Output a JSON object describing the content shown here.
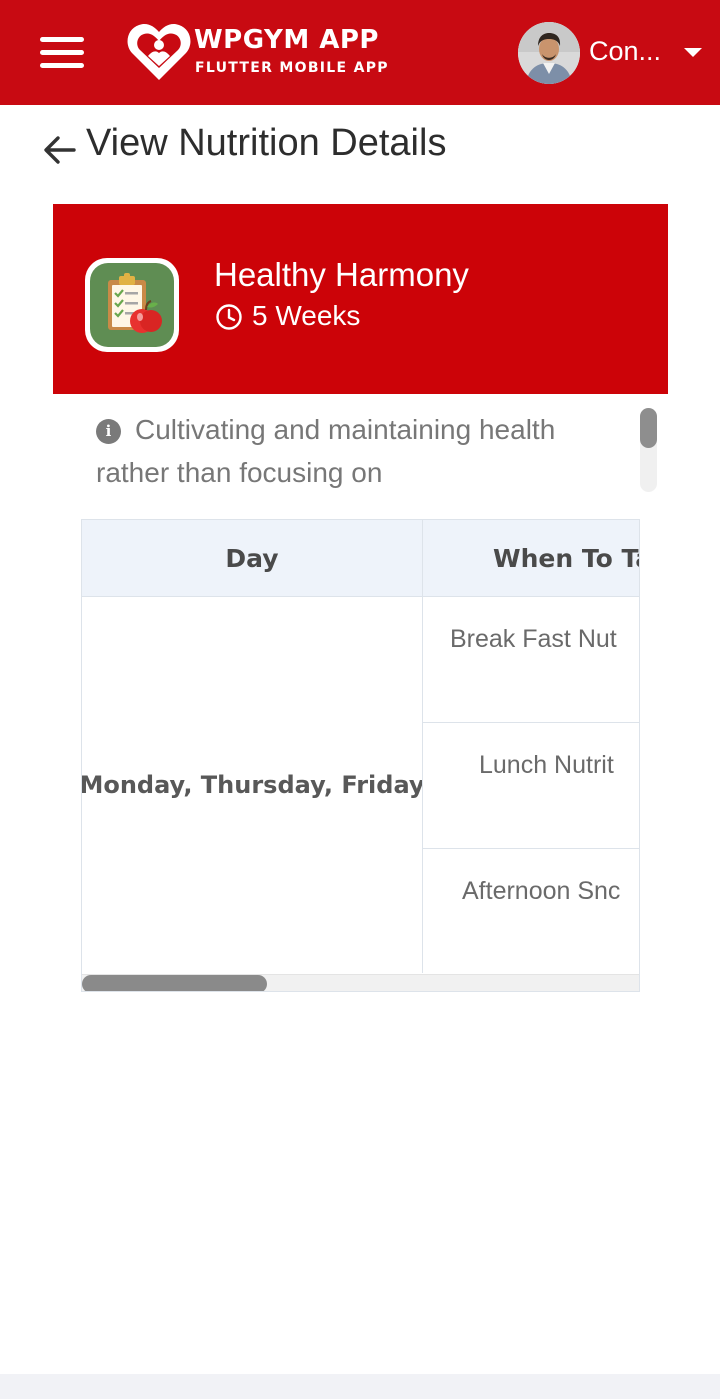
{
  "header": {
    "brand_title": "WPGYM APP",
    "brand_subtitle": "FLUTTER MOBILE APP",
    "user_name": "Con...",
    "bg_color": "#c80a12"
  },
  "page": {
    "title": "View Nutrition Details"
  },
  "plan": {
    "name": "Healthy Harmony",
    "duration": "5 Weeks",
    "description": "Cultivating and maintaining health rather than focusing on",
    "card_color": "#cc0308"
  },
  "table": {
    "headers": [
      "Day",
      "When To Ta"
    ],
    "day": "Monday, Thursday, Friday",
    "meals": [
      "Break Fast Nut",
      "Lunch Nutrit",
      "Afternoon Snc"
    ]
  },
  "icons": [
    "menu-icon",
    "heart-logo-icon",
    "chevron-down-icon",
    "back-arrow-icon",
    "clipboard-apple-icon",
    "clock-icon",
    "info-icon"
  ]
}
